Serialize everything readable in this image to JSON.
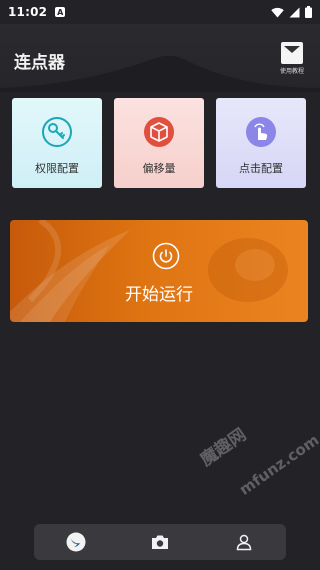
{
  "status_bar": {
    "time": "11:02",
    "notification_glyph": "A"
  },
  "app": {
    "title": "连点器",
    "tutorial_label": "使用教程"
  },
  "cards": [
    {
      "label": "权限配置",
      "icon": "key-icon",
      "color": "#1aa7b7"
    },
    {
      "label": "偏移量",
      "icon": "cube-icon",
      "color": "#e1503f"
    },
    {
      "label": "点击配置",
      "icon": "tap-icon",
      "color": "#8b86e8"
    }
  ],
  "start_button": {
    "label": "开始运行",
    "icon": "power-icon"
  },
  "watermark": {
    "site_cn": "魔趣网",
    "site_en": "mfunz.com"
  },
  "bottom_nav": [
    {
      "icon": "bird-icon"
    },
    {
      "icon": "camera-icon"
    },
    {
      "icon": "user-icon"
    }
  ]
}
